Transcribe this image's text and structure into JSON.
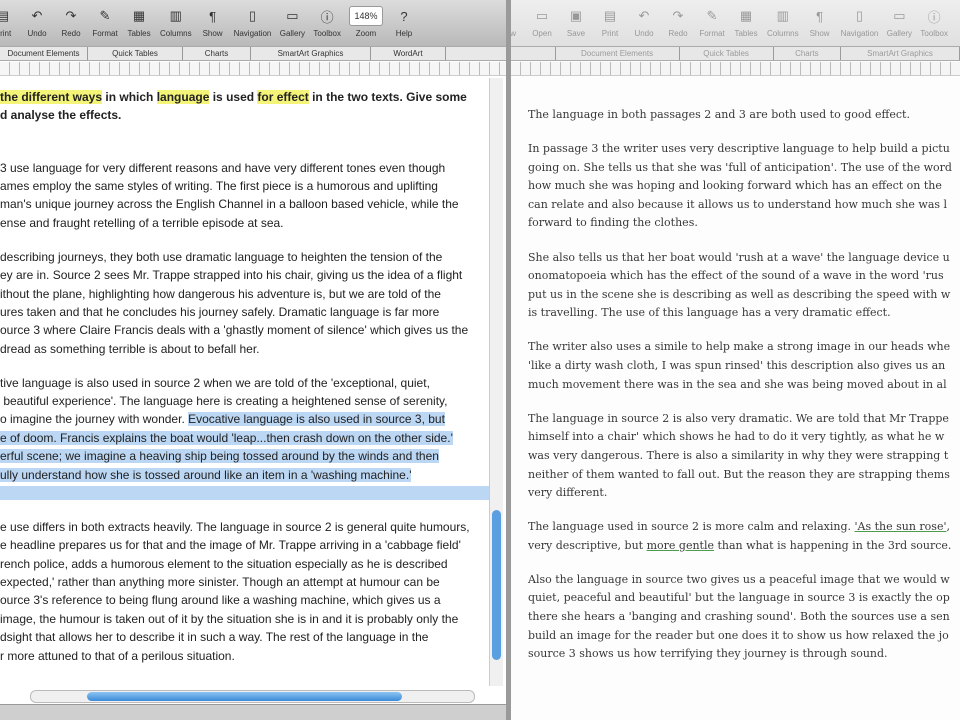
{
  "left": {
    "toolbar": [
      {
        "icon": "print-icon",
        "label": "Print",
        "glyph": "▤"
      },
      {
        "icon": "undo-icon",
        "label": "Undo",
        "glyph": "↶"
      },
      {
        "icon": "redo-icon",
        "label": "Redo",
        "glyph": "↷"
      },
      {
        "icon": "format-icon",
        "label": "Format",
        "glyph": "✎"
      },
      {
        "icon": "tables-icon",
        "label": "Tables",
        "glyph": "▦"
      },
      {
        "icon": "columns-icon",
        "label": "Columns",
        "glyph": "▥"
      },
      {
        "icon": "show-icon",
        "label": "Show",
        "glyph": "¶"
      },
      {
        "icon": "navigation-icon",
        "label": "Navigation",
        "glyph": "▯"
      },
      {
        "icon": "gallery-icon",
        "label": "Gallery",
        "glyph": "▭"
      },
      {
        "icon": "toolbox-icon",
        "label": "Toolbox",
        "glyph": "ⓘ"
      },
      {
        "icon": "zoom-select",
        "label": "Zoom",
        "glyph": "148%"
      },
      {
        "icon": "help-icon",
        "label": "Help",
        "glyph": "?"
      }
    ],
    "ribbon": [
      "Document Elements",
      "Quick Tables",
      "Charts",
      "SmartArt Graphics",
      "WordArt"
    ],
    "paragraphs": [
      [
        [
          {
            "t": "the different ways",
            "c": "b hl"
          },
          {
            "t": " in which ",
            "c": "b"
          },
          {
            "t": "language",
            "c": "b hl"
          },
          {
            "t": " is used ",
            "c": "b"
          },
          {
            "t": "for effect",
            "c": "b hl"
          },
          {
            "t": " in the two texts. Give some",
            "c": "b"
          }
        ],
        [
          {
            "t": "d analyse the effects.",
            "c": "b"
          }
        ],
        [
          {
            "t": " "
          }
        ]
      ],
      [
        [
          "3 use language for very different reasons and have very different tones even though"
        ],
        [
          "ames employ the same styles of writing. The first piece is a humorous and uplifting"
        ],
        [
          "man's unique journey across the English Channel in a balloon based vehicle, while the"
        ],
        [
          "ense and fraught retelling of a terrible episode at sea."
        ]
      ],
      [
        [
          "describing journeys, they both use dramatic language to heighten the tension of the"
        ],
        [
          "ey are in. Source 2 sees Mr. Trappe strapped into his chair, giving us the idea of a flight"
        ],
        [
          "ithout the plane, highlighting how dangerous his adventure is, but we are told of the"
        ],
        [
          "ures taken and that he concludes his journey safely. Dramatic language is far more"
        ],
        [
          "ource 3 where Claire Francis deals with a 'ghastly moment of silence' which gives us the"
        ],
        [
          "dread as something terrible is about to befall her."
        ]
      ],
      [
        [
          "tive language is also used in source 2 when we are told of the 'exceptional, quiet,"
        ],
        [
          " beautiful experience'. The language here is creating a heightened sense of serenity,"
        ],
        [
          {
            "t": "o imagine the journey with wonder. "
          },
          {
            "t": "Evocative language is also used in source 3, but",
            "c": "sel"
          }
        ],
        [
          {
            "t": "e of doom. Francis explains the boat would 'leap...then crash down on the other side.'",
            "c": "sel"
          }
        ],
        [
          {
            "t": "erful scene; we imagine a heaving ship being tossed around by the winds and then",
            "c": "sel"
          }
        ],
        [
          {
            "t": "ully understand how she is tossed around like an item in a 'washing machine.'",
            "c": "sel"
          }
        ],
        [
          {
            "t": "                                                                                                                                                   ",
            "c": "sel"
          }
        ]
      ],
      [
        [
          "e use differs in both extracts heavily. The language in source 2 is general quite humours,"
        ],
        [
          "e headline prepares us for that and the image of Mr. Trappe arriving in a 'cabbage field'"
        ],
        [
          "rench police, adds a humorous element to the situation especially as he is described"
        ],
        [
          "expected,' rather than anything more sinister. Though an attempt at humour can be"
        ],
        [
          "ource 3's reference to being flung around like a washing machine, which gives us a"
        ],
        [
          "image, the humour is taken out of it by the situation she is in and it is probably only the"
        ],
        [
          "dsight that allows her to describe it in such a way. The rest of the language in the"
        ],
        [
          "r more attuned to that of a perilous situation."
        ]
      ]
    ]
  },
  "right": {
    "toolbar": [
      {
        "icon": "new-icon",
        "label": "New",
        "glyph": "▫"
      },
      {
        "icon": "open-icon",
        "label": "Open",
        "glyph": "▭"
      },
      {
        "icon": "save-icon",
        "label": "Save",
        "glyph": "▣"
      },
      {
        "icon": "print-icon",
        "label": "Print",
        "glyph": "▤"
      },
      {
        "icon": "undo-icon",
        "label": "Undo",
        "glyph": "↶"
      },
      {
        "icon": "redo-icon",
        "label": "Redo",
        "glyph": "↷"
      },
      {
        "icon": "format-icon",
        "label": "Format",
        "glyph": "✎"
      },
      {
        "icon": "tables-icon",
        "label": "Tables",
        "glyph": "▦"
      },
      {
        "icon": "columns-icon",
        "label": "Columns",
        "glyph": "▥"
      },
      {
        "icon": "show-icon",
        "label": "Show",
        "glyph": "¶"
      },
      {
        "icon": "navigation-icon",
        "label": "Navigation",
        "glyph": "▯"
      },
      {
        "icon": "gallery-icon",
        "label": "Gallery",
        "glyph": "▭"
      },
      {
        "icon": "toolbox-icon",
        "label": "Toolbox",
        "glyph": "ⓘ"
      }
    ],
    "ribbon": [
      "Document Elements",
      "Quick Tables",
      "Charts",
      "SmartArt Graphics"
    ],
    "paragraphs": [
      [
        [
          "The language in both passages 2 and 3 are both used to good effect."
        ]
      ],
      [
        [
          "In passage 3 the writer uses very descriptive language to help build a pictu"
        ],
        [
          "going on. She tells us that she was 'full of anticipation'. The use of the word"
        ],
        [
          "how much she was hoping and looking forward which has an effect on the"
        ],
        [
          "can relate and also because it allows us to understand how much she was l"
        ],
        [
          "forward to finding the clothes."
        ]
      ],
      [
        [
          "She also tells us that her boat would 'rush at a wave' the language device u"
        ],
        [
          "onomatopoeia which has the effect of the sound of a wave in the word 'rus"
        ],
        [
          "put us in the scene she is describing as well as describing the speed with w"
        ],
        [
          "is travelling. The use of this language has a very dramatic effect."
        ]
      ],
      [
        [
          "The writer also uses a simile to help make a strong image in our heads whe"
        ],
        [
          "'like a dirty wash cloth, I was spun rinsed' this description also gives us an"
        ],
        [
          "much movement there was in the sea and she was being moved about in al"
        ]
      ],
      [
        [
          "The language in source 2 is also very dramatic. We are told that Mr Trappe"
        ],
        [
          "himself into a chair' which shows he had to do it very tightly, as what he w"
        ],
        [
          "was very dangerous. There is also a similarity in why they were strapping t"
        ],
        [
          "neither of them wanted to fall out. But the reason they are strapping thems"
        ],
        [
          "very different."
        ]
      ],
      [
        [
          {
            "t": "The language used in source 2 is more calm and relaxing. "
          },
          {
            "t": "'As the sun rose'",
            "c": "gu"
          },
          {
            "t": ","
          }
        ],
        [
          {
            "t": "very descriptive, but "
          },
          {
            "t": "more gentle",
            "c": "gu"
          },
          {
            "t": " than what is happening in the 3rd source."
          }
        ]
      ],
      [
        [
          "Also the language in source two gives us a peaceful image that we would w"
        ],
        [
          "quiet, peaceful and beautiful' but the language in source 3 is exactly the op"
        ],
        [
          "there she hears a 'banging and crashing sound'. Both the sources use a sen"
        ],
        [
          "build an image for the reader but one does it to show us how relaxed the jo"
        ],
        [
          "source 3 shows us how terrifying they journey is through sound."
        ]
      ]
    ]
  }
}
